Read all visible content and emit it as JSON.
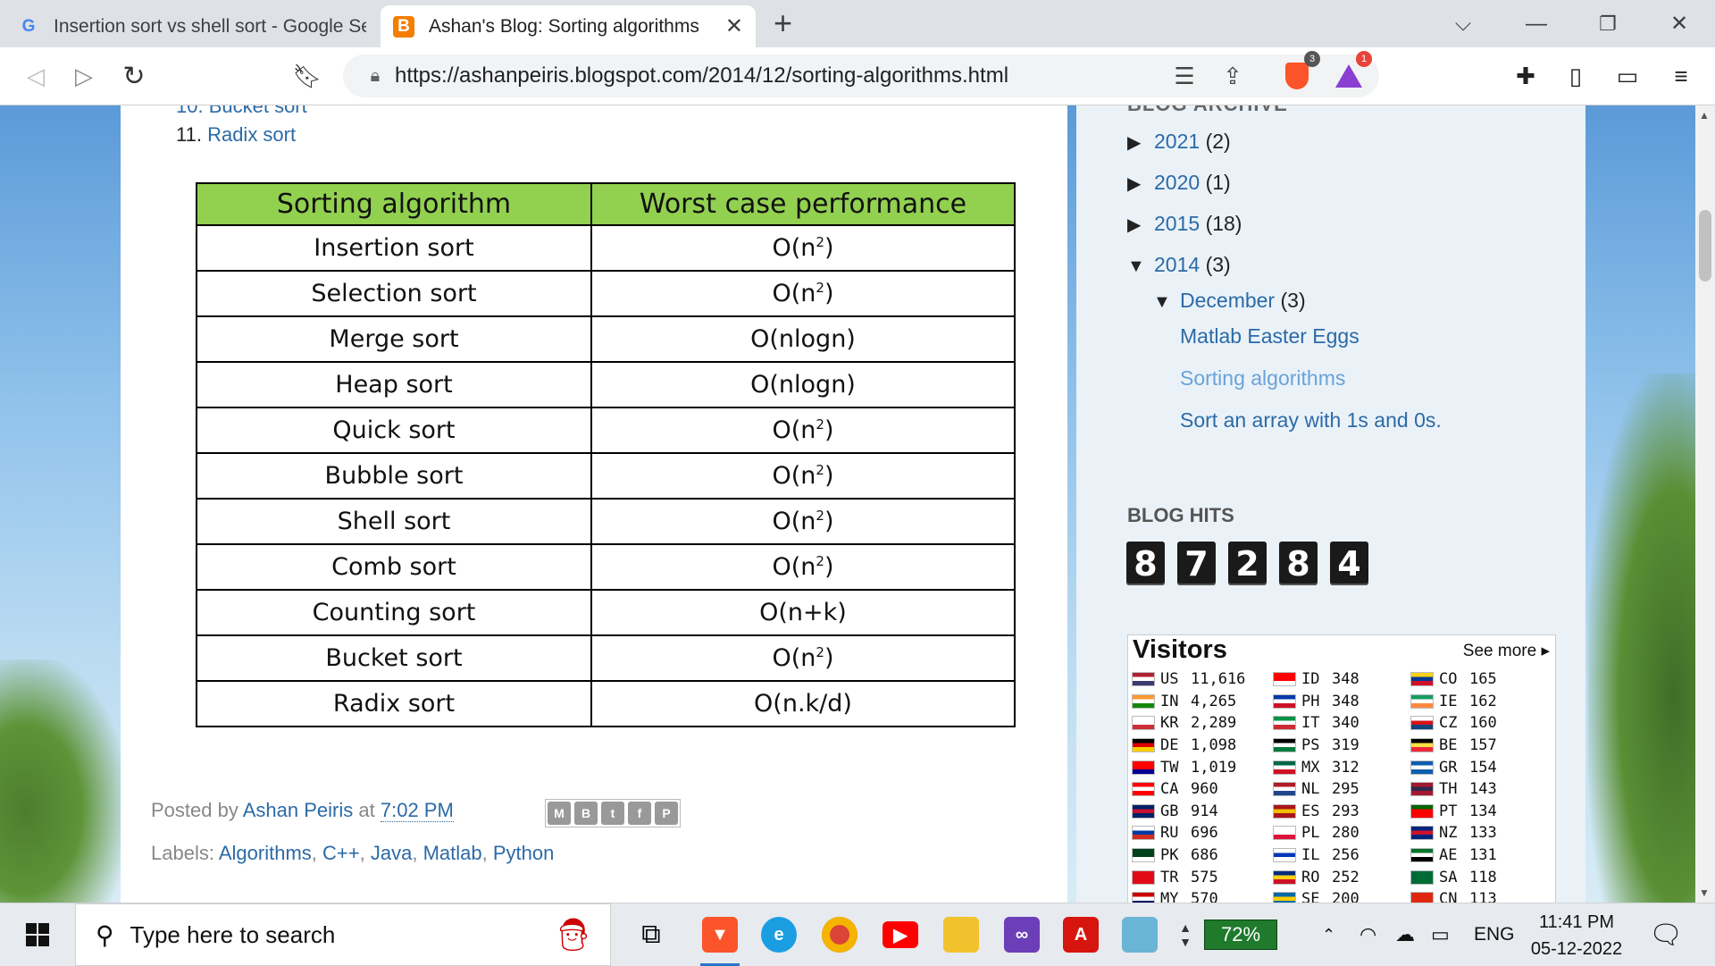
{
  "browser": {
    "tabs": [
      {
        "title": "Insertion sort vs shell sort - Google Se",
        "favicon": "google-icon",
        "active": false
      },
      {
        "title": "Ashan's Blog: Sorting algorithms",
        "favicon": "blogger-icon",
        "active": true
      }
    ],
    "url": "https://ashanpeiris.blogspot.com/2014/12/sorting-algorithms.html",
    "brave_shield_count": "3",
    "brave_rewards_count": "1"
  },
  "post": {
    "list_item_number": "11.",
    "list_item_link": "Radix sort",
    "table": {
      "headers": [
        "Sorting algorithm",
        "Worst case performance"
      ],
      "rows": [
        {
          "name": "Insertion sort",
          "base": "O(n",
          "sup": "2",
          "tail": ")"
        },
        {
          "name": "Selection sort",
          "base": "O(n",
          "sup": "2",
          "tail": ")"
        },
        {
          "name": "Merge sort",
          "base": "O(nlogn)",
          "sup": "",
          "tail": ""
        },
        {
          "name": "Heap sort",
          "base": "O(nlogn)",
          "sup": "",
          "tail": ""
        },
        {
          "name": "Quick sort",
          "base": "O(n",
          "sup": "2",
          "tail": ")"
        },
        {
          "name": "Bubble sort",
          "base": "O(n",
          "sup": "2",
          "tail": ")"
        },
        {
          "name": "Shell sort",
          "base": "O(n",
          "sup": "2",
          "tail": ")"
        },
        {
          "name": "Comb sort",
          "base": "O(n",
          "sup": "2",
          "tail": ")"
        },
        {
          "name": "Counting sort",
          "base": "O(n+k)",
          "sup": "",
          "tail": ""
        },
        {
          "name": "Bucket sort",
          "base": "O(n",
          "sup": "2",
          "tail": ")"
        },
        {
          "name": "Radix sort",
          "base": "O(n.k/d)",
          "sup": "",
          "tail": ""
        }
      ]
    },
    "posted_by_prefix": "Posted by",
    "author": "Ashan Peiris",
    "at_text": "at",
    "time": "7:02 PM",
    "labels_prefix": "Labels:",
    "labels": [
      "Algorithms",
      "C++",
      "Java",
      "Matlab",
      "Python"
    ]
  },
  "sidebar": {
    "archive_heading": "BLOG ARCHIVE",
    "archive": [
      {
        "year": "2021",
        "count": "(2)",
        "expanded": false
      },
      {
        "year": "2020",
        "count": "(1)",
        "expanded": false
      },
      {
        "year": "2015",
        "count": "(18)",
        "expanded": false
      },
      {
        "year": "2014",
        "count": "(3)",
        "expanded": true
      }
    ],
    "month": {
      "name": "December",
      "count": "(3)"
    },
    "posts": [
      "Matlab Easter Eggs",
      "Sorting algorithms",
      "Sort an array with 1s and 0s."
    ],
    "hits_title": "BLOG HITS",
    "hits_digits": [
      "8",
      "7",
      "2",
      "8",
      "4"
    ],
    "visitors": {
      "title": "Visitors",
      "see_more": "See more",
      "columns": [
        [
          {
            "code": "US",
            "count": "11,616"
          },
          {
            "code": "IN",
            "count": "4,265"
          },
          {
            "code": "KR",
            "count": "2,289"
          },
          {
            "code": "DE",
            "count": "1,098"
          },
          {
            "code": "TW",
            "count": "1,019"
          },
          {
            "code": "CA",
            "count": "960"
          },
          {
            "code": "GB",
            "count": "914"
          },
          {
            "code": "RU",
            "count": "696"
          },
          {
            "code": "PK",
            "count": "686"
          },
          {
            "code": "TR",
            "count": "575"
          },
          {
            "code": "MY",
            "count": "570"
          }
        ],
        [
          {
            "code": "ID",
            "count": "348"
          },
          {
            "code": "PH",
            "count": "348"
          },
          {
            "code": "IT",
            "count": "340"
          },
          {
            "code": "PS",
            "count": "319"
          },
          {
            "code": "MX",
            "count": "312"
          },
          {
            "code": "NL",
            "count": "295"
          },
          {
            "code": "ES",
            "count": "293"
          },
          {
            "code": "PL",
            "count": "280"
          },
          {
            "code": "IL",
            "count": "256"
          },
          {
            "code": "RO",
            "count": "252"
          },
          {
            "code": "SE",
            "count": "200"
          }
        ],
        [
          {
            "code": "CO",
            "count": "165"
          },
          {
            "code": "IE",
            "count": "162"
          },
          {
            "code": "CZ",
            "count": "160"
          },
          {
            "code": "BE",
            "count": "157"
          },
          {
            "code": "GR",
            "count": "154"
          },
          {
            "code": "TH",
            "count": "143"
          },
          {
            "code": "PT",
            "count": "134"
          },
          {
            "code": "NZ",
            "count": "133"
          },
          {
            "code": "AE",
            "count": "131"
          },
          {
            "code": "SA",
            "count": "118"
          },
          {
            "code": "CN",
            "count": "113"
          }
        ]
      ]
    }
  },
  "taskbar": {
    "search_placeholder": "Type here to search",
    "battery": "72%",
    "language": "ENG",
    "time": "11:41 PM",
    "date": "05-12-2022"
  }
}
